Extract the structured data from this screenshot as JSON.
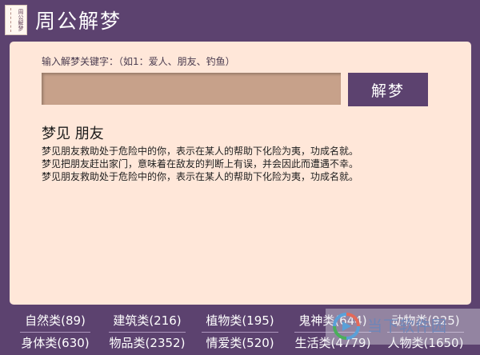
{
  "header": {
    "logo_text": "周公解梦",
    "title": "周公解梦"
  },
  "search": {
    "hint": "输入解梦关键字：（如1：爱人、朋友、钓鱼）",
    "value": "",
    "button_label": "解梦"
  },
  "result": {
    "title": "梦见 朋友",
    "lines": [
      "梦见朋友救助处于危险中的你，表示在某人的帮助下化险为夷，功成名就。",
      "梦见把朋友赶出家门，意味着在敌友的判断上有误，并会因此而遭遇不幸。",
      "梦见朋友救助处于危险中的你，表示在某人的帮助下化险为夷，功成名就。"
    ]
  },
  "categories": {
    "row1": [
      "自然类(89)",
      "建筑类(216)",
      "植物类(195)",
      "鬼神类(644)",
      "动物类(925)"
    ],
    "row2": [
      "身体类(630)",
      "物品类(2352)",
      "情爱类(520)",
      "生活类(4779)",
      "人物类(1650)"
    ]
  },
  "watermark": {
    "icon": "download-site-logo-icon",
    "text": "当下软件园"
  },
  "colors": {
    "background": "#5c426f",
    "panel": "#ffe7d9",
    "input": "#c7a18a",
    "button": "#5c426f"
  }
}
